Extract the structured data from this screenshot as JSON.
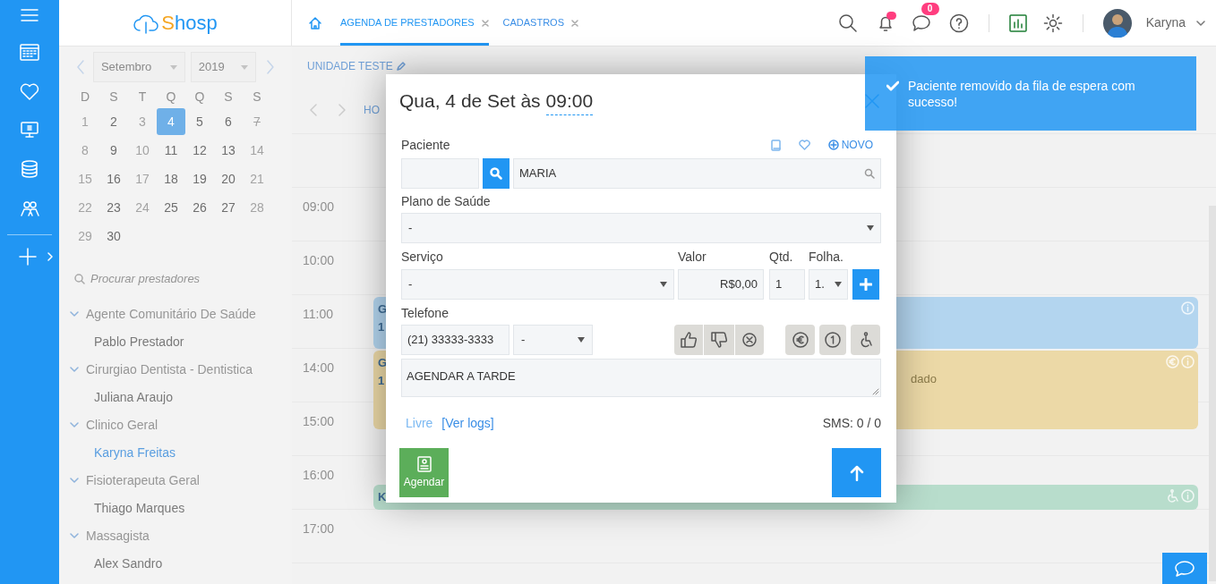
{
  "header": {
    "logo": "Shosp",
    "tabs": [
      {
        "label": "AGENDA DE PRESTADORES",
        "selected": true
      },
      {
        "label": "CADASTROS",
        "selected": false
      }
    ],
    "bell_alert": true,
    "messages_badge": "0",
    "user": "Karyna"
  },
  "calendar": {
    "month": "Setembro",
    "year": "2019",
    "weekdays": [
      "D",
      "S",
      "T",
      "Q",
      "Q",
      "S",
      "S"
    ],
    "days": [
      {
        "day": "1",
        "muted": true,
        "selected": false,
        "crossed": false
      },
      {
        "day": "2",
        "muted": false,
        "selected": false,
        "crossed": false
      },
      {
        "day": "3",
        "muted": true,
        "selected": false,
        "crossed": false
      },
      {
        "day": "4",
        "muted": false,
        "selected": true,
        "crossed": false
      },
      {
        "day": "5",
        "muted": false,
        "selected": false,
        "crossed": false
      },
      {
        "day": "6",
        "muted": false,
        "selected": false,
        "crossed": false
      },
      {
        "day": "7",
        "muted": true,
        "selected": false,
        "crossed": true
      },
      {
        "day": "8",
        "muted": true,
        "selected": false,
        "crossed": false
      },
      {
        "day": "9",
        "muted": false,
        "selected": false,
        "crossed": false
      },
      {
        "day": "10",
        "muted": true,
        "selected": false,
        "crossed": false
      },
      {
        "day": "11",
        "muted": false,
        "selected": false,
        "crossed": false
      },
      {
        "day": "12",
        "muted": false,
        "selected": false,
        "crossed": false
      },
      {
        "day": "13",
        "muted": false,
        "selected": false,
        "crossed": false
      },
      {
        "day": "14",
        "muted": true,
        "selected": false,
        "crossed": false
      },
      {
        "day": "15",
        "muted": true,
        "selected": false,
        "crossed": false
      },
      {
        "day": "16",
        "muted": false,
        "selected": false,
        "crossed": false
      },
      {
        "day": "17",
        "muted": true,
        "selected": false,
        "crossed": false
      },
      {
        "day": "18",
        "muted": false,
        "selected": false,
        "crossed": false
      },
      {
        "day": "19",
        "muted": false,
        "selected": false,
        "crossed": false
      },
      {
        "day": "20",
        "muted": false,
        "selected": false,
        "crossed": false
      },
      {
        "day": "21",
        "muted": true,
        "selected": false,
        "crossed": false
      },
      {
        "day": "22",
        "muted": true,
        "selected": false,
        "crossed": false
      },
      {
        "day": "23",
        "muted": false,
        "selected": false,
        "crossed": false
      },
      {
        "day": "24",
        "muted": true,
        "selected": false,
        "crossed": false
      },
      {
        "day": "25",
        "muted": false,
        "selected": false,
        "crossed": false
      },
      {
        "day": "26",
        "muted": false,
        "selected": false,
        "crossed": false
      },
      {
        "day": "27",
        "muted": false,
        "selected": false,
        "crossed": false
      },
      {
        "day": "28",
        "muted": true,
        "selected": false,
        "crossed": false
      },
      {
        "day": "29",
        "muted": true,
        "selected": false,
        "crossed": false
      },
      {
        "day": "30",
        "muted": false,
        "selected": false,
        "crossed": false
      }
    ]
  },
  "provider_search": {
    "placeholder": "Procurar prestadores"
  },
  "providers": [
    {
      "label": "Agente Comunitário De Saúde",
      "expanded": true,
      "children": [
        {
          "label": "Pablo Prestador",
          "selected": false
        }
      ]
    },
    {
      "label": "Cirurgiao Dentista - Dentistica",
      "expanded": true,
      "children": [
        {
          "label": "Juliana Araujo",
          "selected": false
        }
      ]
    },
    {
      "label": "Clinico Geral",
      "expanded": true,
      "children": [
        {
          "label": "Karyna Freitas",
          "selected": true
        }
      ]
    },
    {
      "label": "Fisioterapeuta Geral",
      "expanded": true,
      "children": [
        {
          "label": "Thiago Marques",
          "selected": false
        }
      ]
    },
    {
      "label": "Massagista",
      "expanded": true,
      "children": [
        {
          "label": "Alex Sandro",
          "selected": false
        }
      ]
    }
  ],
  "schedule": {
    "unit": "UNIDADE TESTE",
    "view_label": "HO",
    "slots": [
      {
        "time": "09:00"
      },
      {
        "time": "10:00"
      },
      {
        "time": "11:00",
        "events": [
          {
            "color": "#b3d5ef",
            "lines": [
              "G",
              "1"
            ],
            "paid": false,
            "accessible": false
          }
        ]
      },
      {
        "time": "14:00",
        "events": [
          {
            "color": "#ecd9a7",
            "lines": [
              "G",
              "1"
            ],
            "right_text": "dado",
            "paid": true,
            "accessible": false
          }
        ]
      },
      {
        "time": "15:00"
      },
      {
        "time": "16:00",
        "events": [
          {
            "color": "#b8ddcc",
            "lines": [
              "K"
            ],
            "paid": false,
            "accessible": true
          }
        ]
      },
      {
        "time": "17:00"
      }
    ]
  },
  "modal": {
    "title": "Qua, 4 de Set às",
    "time": "09:00",
    "patient_label": "Paciente",
    "new_label": "NOVO",
    "patient_name": "MARIA",
    "plan_label": "Plano de Saúde",
    "plan_value": "-",
    "service_label": "Serviço",
    "service_value": "-",
    "value_label": "Valor",
    "value": "R$0,00",
    "qty_label": "Qtd.",
    "qty": "1",
    "sheet_label": "Folha.",
    "sheet_value": "1.",
    "phone_label": "Telefone",
    "phone": "(21) 33333-3333",
    "phone_type": "-",
    "notes": "AGENDAR A TARDE",
    "status_link": "Livre",
    "logs_link": "[Ver logs]",
    "sms": "SMS: 0 / 0",
    "schedule_button": "Agendar"
  },
  "toast": {
    "message": "Paciente removido da fila de espera com sucesso!"
  }
}
